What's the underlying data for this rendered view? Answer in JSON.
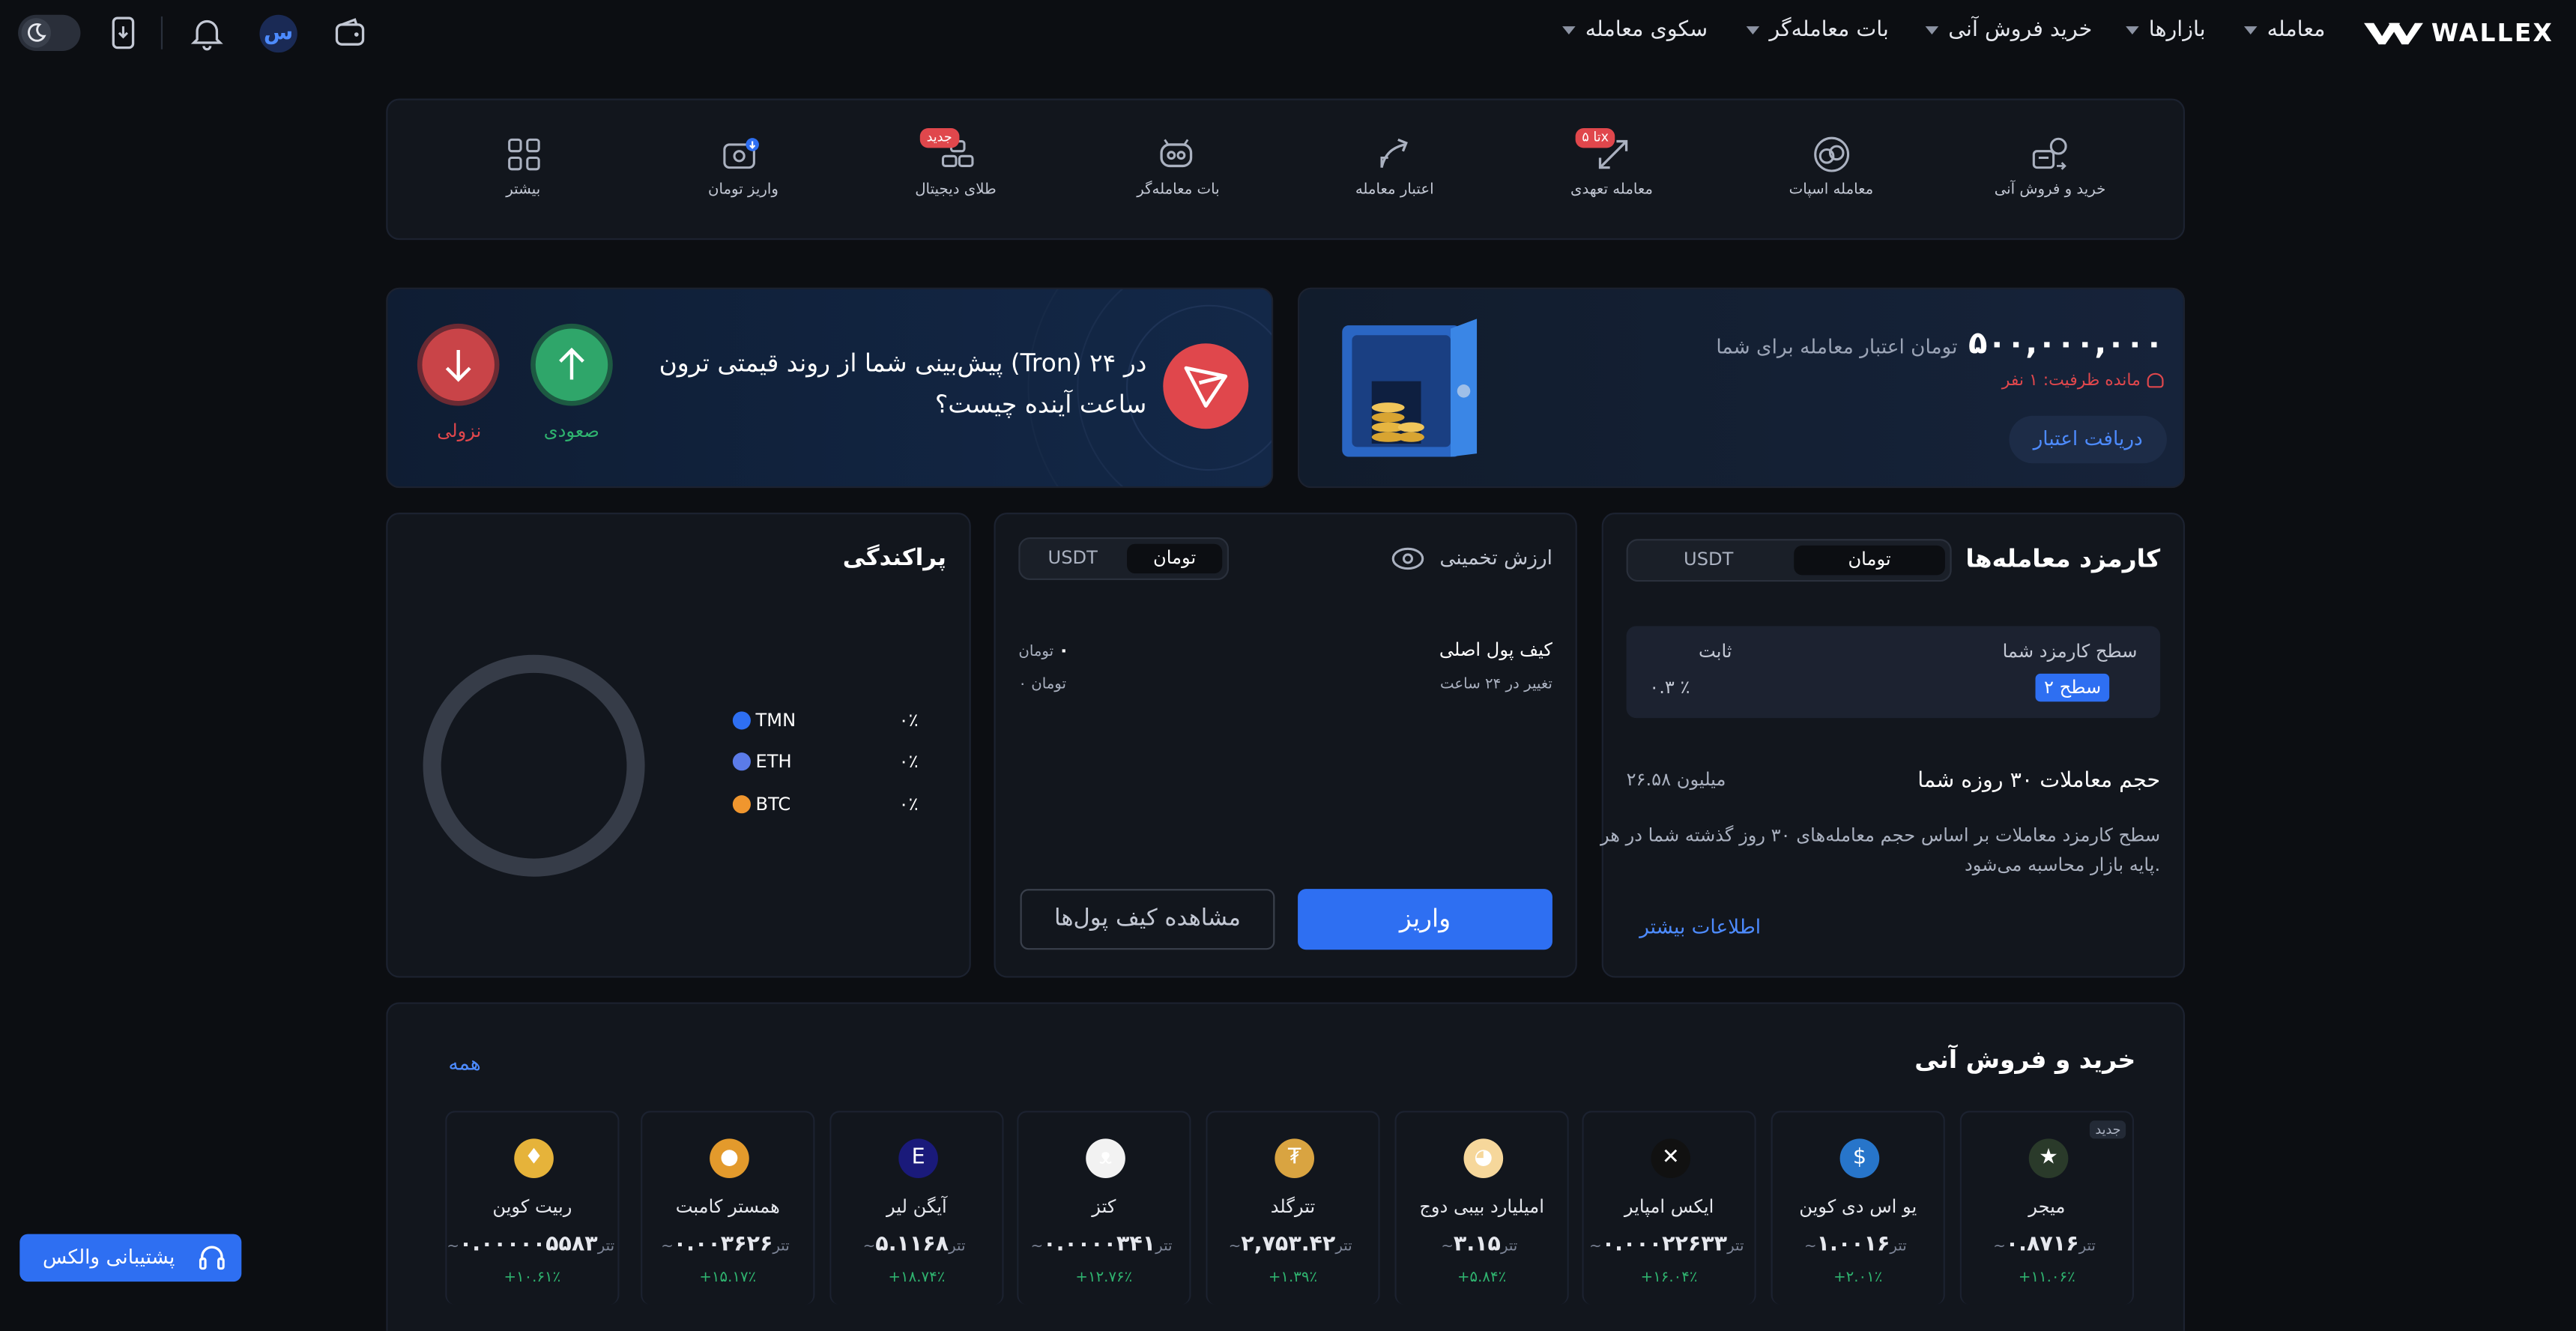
{
  "brand": {
    "name": "WALLEX"
  },
  "nav": {
    "items": [
      {
        "label": "معامله"
      },
      {
        "label": "بازارها"
      },
      {
        "label": "خرید فروش آنی"
      },
      {
        "label": "بات معامله‌گر"
      },
      {
        "label": "سکوی معامله"
      }
    ]
  },
  "header": {
    "avatar_letter": "س"
  },
  "actions": [
    {
      "label": "خرید و فروش آنی",
      "icon": "instant-trade-icon"
    },
    {
      "label": "معامله اسپات",
      "icon": "spot-trade-icon"
    },
    {
      "label": "معامله تعهدی",
      "icon": "margin-trade-icon",
      "badge": "تا ۵x"
    },
    {
      "label": "اعتبار معامله",
      "icon": "credit-icon"
    },
    {
      "label": "بات معامله‌گر",
      "icon": "bot-icon"
    },
    {
      "label": "طلای دیجیتال",
      "icon": "gold-icon",
      "badge": "جدید"
    },
    {
      "label": "واریز تومان",
      "icon": "deposit-icon"
    },
    {
      "label": "بیشتر",
      "icon": "more-grid-icon"
    }
  ],
  "credit_banner": {
    "amount": "۵۰۰,۰۰۰,۰۰۰",
    "amount_suffix": "تومان اعتبار معامله برای شما",
    "capacity": "مانده ظرفیت: ۱ نفر",
    "button": "دریافت اعتبار"
  },
  "prediction": {
    "line1": "پیش‌بینی شما از روند قیمتی ترون (Tron) در ۲۴",
    "line2": "ساعت آینده چیست؟",
    "up_label": "صعودی",
    "down_label": "نزولی"
  },
  "fees": {
    "title": "کارمزد معامله‌ها",
    "toggle": [
      "تومان",
      "USDT"
    ],
    "level_label": "سطح کارمزد شما",
    "level_value": "سطح ۲",
    "fixed_label": "ثابت",
    "fixed_value": "۰.۳ ٪",
    "volume_label": "حجم معاملات ۳۰ روزه شما",
    "volume_value": "۲۶.۵۸ میلیون",
    "desc1": "سطح کارمزد معاملات بر اساس حجم معامله‌های ۳۰ روز گذشته شما در هر",
    "desc2": "پایه بازار محاسبه می‌شود.",
    "more_link": "اطلاعات بیشتر"
  },
  "wallet": {
    "title": "ارزش تخمینی",
    "toggle": [
      "تومان",
      "USDT"
    ],
    "main_label": "کیف پول اصلی",
    "main_value": "۰",
    "main_unit": "تومان",
    "change_label": "تغییر در ۲۴ ساعت",
    "change_value": "۰ تومان",
    "deposit_btn": "واریز",
    "view_btn": "مشاهده کیف پول‌ها"
  },
  "distribution": {
    "title": "پراکندگی",
    "items": [
      {
        "name": "TMN",
        "pct": "۰٪",
        "color": "#2e6ff2"
      },
      {
        "name": "ETH",
        "pct": "۰٪",
        "color": "#5b7be8"
      },
      {
        "name": "BTC",
        "pct": "۰٪",
        "color": "#f0962e"
      }
    ]
  },
  "instant": {
    "title": "خرید و فروش آنی",
    "all_link": "همه",
    "unit": "~تتر",
    "new_badge": "جدید",
    "coins": [
      {
        "name": "میجر",
        "price": "۰.۸۷۱۶",
        "change": "+۱۱.۰۶٪",
        "icon": "major-icon",
        "color": "#2a3a2a"
      },
      {
        "name": "یو اس دی کوین",
        "price": "۱.۰۰۱۶",
        "change": "+۲.۰۱٪",
        "icon": "usdc-icon",
        "color": "#2775ca"
      },
      {
        "name": "ایکس امپایر",
        "price": "۰.۰۰۰۲۲۶۳۳",
        "change": "+۱۶.۰۴٪",
        "icon": "x-empire-icon",
        "color": "#111"
      },
      {
        "name": "امیلیارد بیبی دوج",
        "price": "۳.۱۵",
        "change": "+۵.۸۴٪",
        "icon": "babydoge-icon",
        "color": "#f6d79b"
      },
      {
        "name": "تترگلد",
        "price": "۲,۷۵۳.۴۲",
        "change": "+۱.۳۹٪",
        "icon": "tether-gold-icon",
        "color": "#d9a441"
      },
      {
        "name": "کتز",
        "price": "۰.۰۰۰۰۳۴۱",
        "change": "+۱۲.۷۶٪",
        "icon": "cats-icon",
        "color": "#f2f2f2"
      },
      {
        "name": "آیگن لیر",
        "price": "۵.۱۱۶۸",
        "change": "+۱۸.۷۴٪",
        "icon": "eigen-icon",
        "color": "#1a1a7a"
      },
      {
        "name": "همستر کامبت",
        "price": "۰.۰۰۳۶۲۶",
        "change": "+۱۵.۱۷٪",
        "icon": "hamster-icon",
        "color": "#e39a2c"
      },
      {
        "name": "ربیت کوین",
        "price": "۰.۰۰۰۰۰۵۵۸۳",
        "change": "+۱۰.۶۱٪",
        "icon": "rabbit-icon",
        "color": "#e6b33a"
      }
    ]
  },
  "support": {
    "label": "پشتیبانی والکس"
  }
}
